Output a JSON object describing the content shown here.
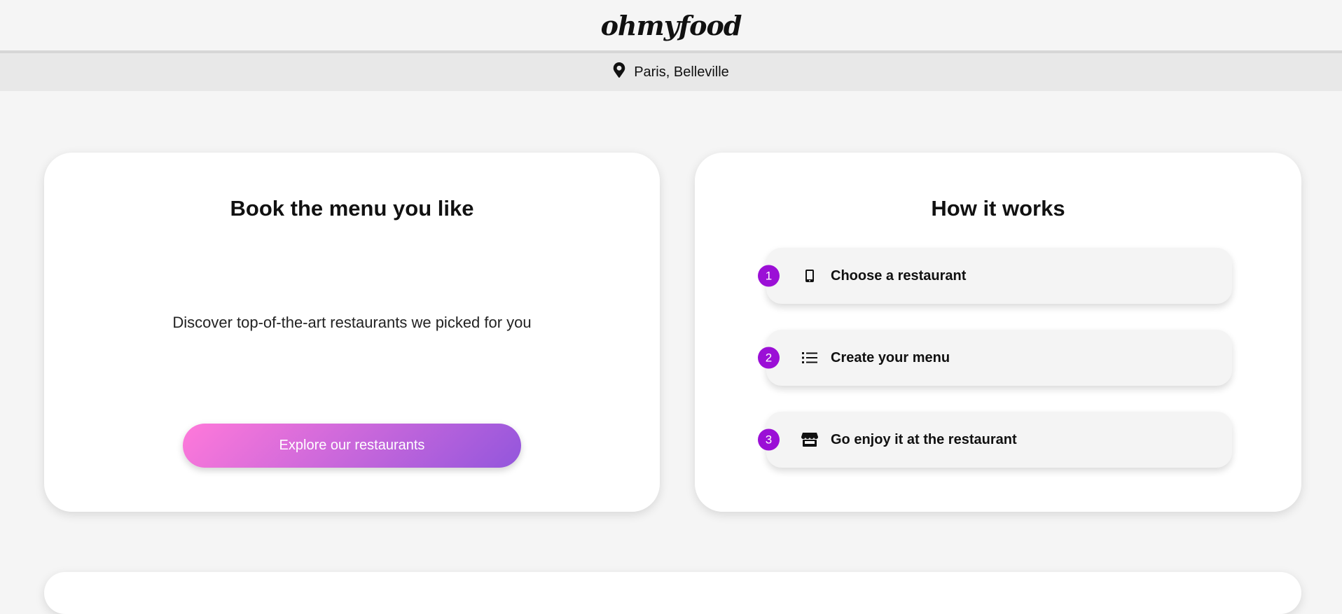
{
  "header": {
    "logo": "ohmyfood"
  },
  "location": {
    "icon": "map-pin-icon",
    "label": "Paris, Belleville"
  },
  "hero": {
    "title": "Book the menu you like",
    "description": "Discover top-of-the-art restaurants we picked for you",
    "cta_label": "Explore our restaurants",
    "cta_gradient": [
      "#ff79da",
      "#9356dc"
    ]
  },
  "how": {
    "title": "How it works",
    "accent": "#9b0fd6",
    "steps": [
      {
        "number": "1",
        "icon": "mobile-phone-icon",
        "label": "Choose a restaurant"
      },
      {
        "number": "2",
        "icon": "list-icon",
        "label": "Create your menu"
      },
      {
        "number": "3",
        "icon": "store-icon",
        "label": "Go enjoy it at the restaurant"
      }
    ]
  }
}
